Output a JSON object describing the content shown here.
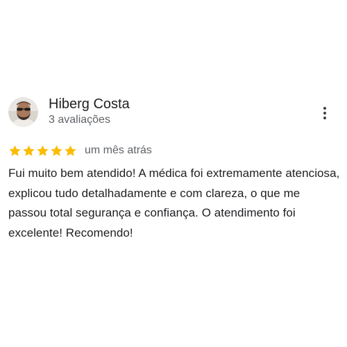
{
  "review": {
    "reviewer_name": "Hiberg Costa",
    "reviewer_meta": "3 avaliações",
    "rating": 5,
    "rating_max": 5,
    "date": "um mês atrás",
    "text": "Fui muito bem atendido! A médica foi extremamente atenciosa, explicou tudo detalhadamente e com clareza, o que me passou total segurança e confiança. O atendimento foi excelente! Recomendo!"
  },
  "icons": {
    "avatar": "profile-photo",
    "menu": "more-vert-icon",
    "star": "star-icon"
  },
  "colors": {
    "star": "#fbbc04",
    "text": "#202124",
    "secondary_text": "#5f6368"
  }
}
